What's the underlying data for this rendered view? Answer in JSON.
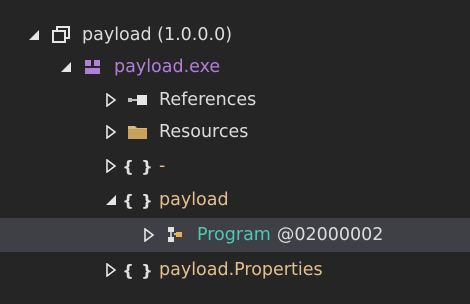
{
  "tree": {
    "assembly": {
      "label": "payload (1.0.0.0)"
    },
    "module": {
      "label": "payload.exe"
    },
    "references": {
      "label": "References"
    },
    "resources": {
      "label": "Resources"
    },
    "ns_empty": {
      "label": "-"
    },
    "ns_payload": {
      "label": "payload"
    },
    "type_program": {
      "name": "Program",
      "token": "@02000002"
    },
    "ns_properties": {
      "label": "payload.Properties"
    }
  },
  "colors": {
    "background": "#252526",
    "selected_row": "#3f3f46",
    "assembly_text": "#dcdcdc",
    "module_text": "#b180d7",
    "namespace_text": "#e2c08d",
    "type_text": "#4ec9b0"
  }
}
